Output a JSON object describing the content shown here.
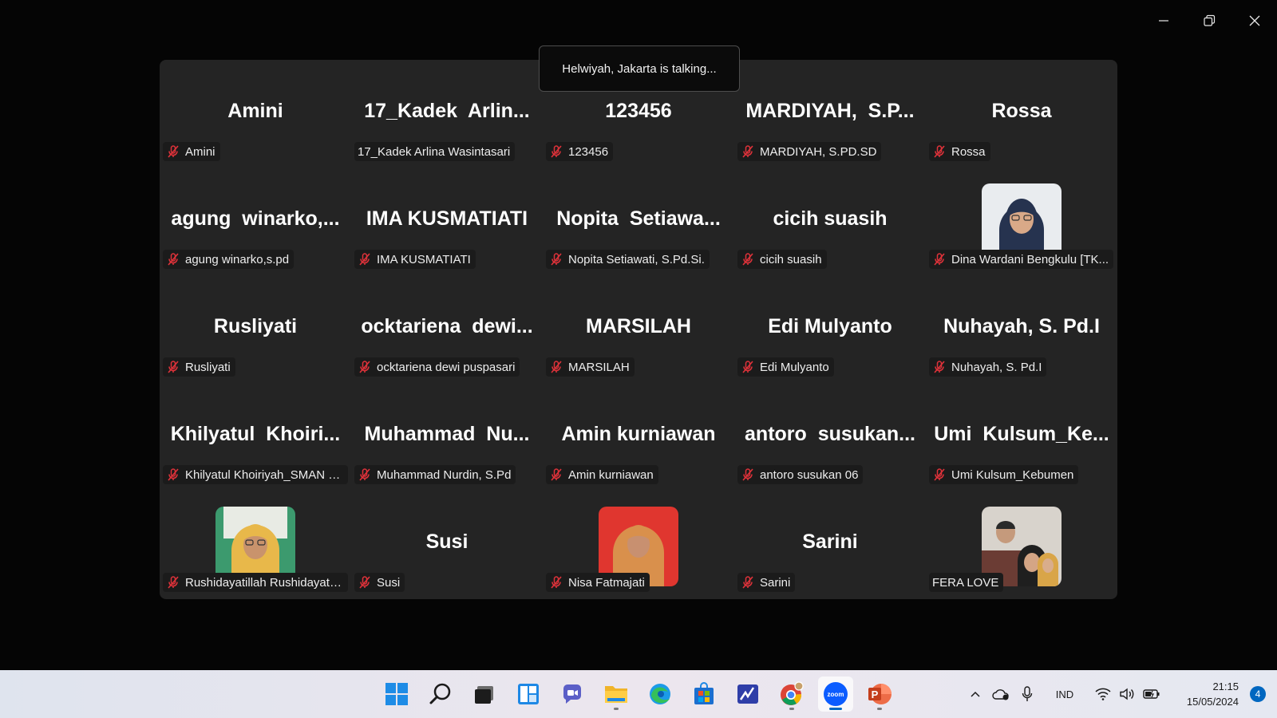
{
  "meeting": {
    "talking_banner": "Helwiyah, Jakarta is talking...",
    "muted_color": "#e0323a",
    "tiles": [
      {
        "display": "Amini",
        "label": "Amini",
        "muted": true
      },
      {
        "display": "17_Kadek  Arlin...",
        "label": "17_Kadek Arlina Wasintasari",
        "muted": false
      },
      {
        "display": "123456",
        "label": "123456",
        "muted": true
      },
      {
        "display": "MARDIYAH,  S.P...",
        "label": "MARDIYAH, S.PD.SD",
        "muted": true
      },
      {
        "display": "Rossa",
        "label": "Rossa",
        "muted": true
      },
      {
        "display": "agung  winarko,...",
        "label": "agung winarko,s.pd",
        "muted": true
      },
      {
        "display": "IMA KUSMATIATI",
        "label": "IMA KUSMATIATI",
        "muted": true
      },
      {
        "display": "Nopita  Setiawa...",
        "label": "Nopita Setiawati, S.Pd.Si.",
        "muted": true
      },
      {
        "display": "cicih suasih",
        "label": "cicih suasih",
        "muted": true
      },
      {
        "display": "",
        "label": "Dina Wardani Bengkulu  [TK...",
        "muted": true,
        "photo": "photo-hijab-navy"
      },
      {
        "display": "Rusliyati",
        "label": "Rusliyati",
        "muted": true
      },
      {
        "display": "ocktariena  dewi...",
        "label": "ocktariena dewi puspasari",
        "muted": true
      },
      {
        "display": "MARSILAH",
        "label": "MARSILAH",
        "muted": true
      },
      {
        "display": "Edi Mulyanto",
        "label": "Edi Mulyanto",
        "muted": true
      },
      {
        "display": "Nuhayah, S. Pd.I",
        "label": "Nuhayah, S. Pd.I",
        "muted": true
      },
      {
        "display": "Khilyatul  Khoiri...",
        "label": "Khilyatul Khoiriyah_SMAN 3 ...",
        "muted": true
      },
      {
        "display": "Muhammad  Nu...",
        "label": "Muhammad Nurdin, S.Pd",
        "muted": true
      },
      {
        "display": "Amin kurniawan",
        "label": "Amin kurniawan",
        "muted": true
      },
      {
        "display": "antoro  susukan...",
        "label": "antoro susukan 06",
        "muted": true
      },
      {
        "display": "Umi  Kulsum_Ke...",
        "label": "Umi Kulsum_Kebumen",
        "muted": true
      },
      {
        "display": "",
        "label": "Rushidayatillah Rushidayatil...",
        "muted": true,
        "photo": "photo-hijab-yellow"
      },
      {
        "display": "Susi",
        "label": "Susi",
        "muted": true
      },
      {
        "display": "",
        "label": "Nisa Fatmajati",
        "muted": true,
        "photo": "photo-hijab-red"
      },
      {
        "display": "Sarini",
        "label": "Sarini",
        "muted": true
      },
      {
        "display": "",
        "label": "FERA LOVE",
        "muted": false,
        "photo": "photo-couple"
      }
    ]
  },
  "window_controls": [
    "minimize-icon",
    "restore-icon",
    "close-icon"
  ],
  "taskbar": {
    "apps": [
      "windows-start-icon",
      "search-icon",
      "task-view-icon",
      "widgets-icon",
      "chat-icon",
      "file-explorer-icon",
      "edge-icon",
      "store-icon",
      "whiteboard-icon",
      "chrome-icon",
      "zoom-icon",
      "powerpoint-icon"
    ],
    "active_app": "zoom-icon",
    "zoom_label": "zoom",
    "powerpoint_letter": "P",
    "language": "IND",
    "time": "21:15",
    "date": "15/05/2024",
    "notifications": "4",
    "accent": "#0067c0"
  }
}
